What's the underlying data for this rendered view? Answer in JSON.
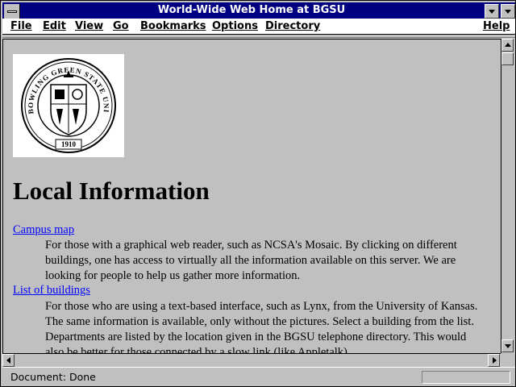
{
  "window": {
    "title": "World-Wide Web Home at BGSU"
  },
  "menubar": {
    "items": [
      {
        "label": "File"
      },
      {
        "label": "Edit"
      },
      {
        "label": "View"
      },
      {
        "label": "Go"
      },
      {
        "label": "Bookmarks"
      },
      {
        "label": "Options"
      },
      {
        "label": "Directory"
      },
      {
        "label": "Help"
      }
    ]
  },
  "content": {
    "logo": {
      "icon": "bgsu-seal-logo",
      "seal_text": "BOWLING GREEN STATE UNIVERSITY",
      "seal_year": "1910"
    },
    "heading": "Local Information",
    "entries": [
      {
        "link": "Campus map",
        "description": "For those with a graphical web reader, such as NCSA's Mosaic. By clicking on different buildings, one has access to virtually all the information available on this server. We are looking for people to help us gather more information."
      },
      {
        "link": "List of buildings",
        "description": "For those who are using a text-based interface, such as Lynx, from the University of Kansas. The same information is available, only without the pictures. Select a building from the list. Departments are listed by the location given in the BGSU telephone directory. This would also be better for those connected by a slow link (like Appletalk)."
      }
    ]
  },
  "statusbar": {
    "text": "Document: Done"
  },
  "colors": {
    "titlebar": "#000080",
    "link": "#0000ff",
    "chrome": "#c0c0c0"
  }
}
